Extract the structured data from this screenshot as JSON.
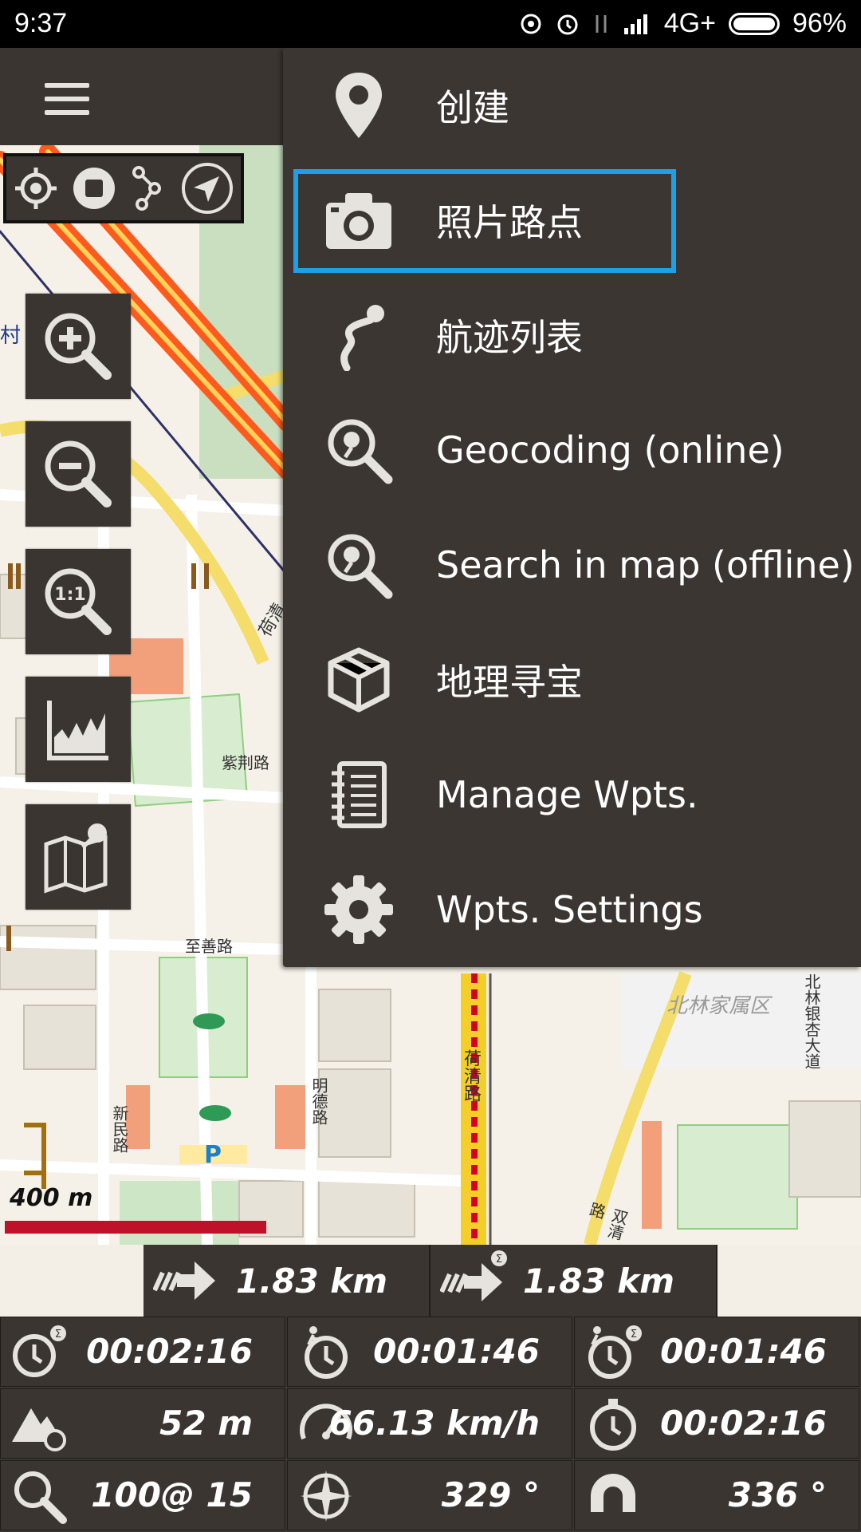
{
  "status_bar": {
    "time": "9:37",
    "network": "4G+",
    "battery": "96%"
  },
  "map": {
    "labels": {
      "road_1": "荷清",
      "road_2": "紫荆路",
      "road_3": "至善路",
      "road_4": "明德路",
      "road_5": "新民路",
      "road_6": "荷清路",
      "road_7": "双清路",
      "road_8": "北林家属区",
      "road_9": "北林银杏大道",
      "edge_char": "村",
      "parking": "P"
    },
    "scale_label": "400 m"
  },
  "menu": {
    "items": [
      {
        "label": "创建",
        "icon": "map-pin-icon"
      },
      {
        "label": "照片路点",
        "icon": "camera-icon"
      },
      {
        "label": "航迹列表",
        "icon": "track-icon"
      },
      {
        "label": "Geocoding (online)",
        "icon": "search-pin-icon"
      },
      {
        "label": "Search in map (offline)",
        "icon": "search-pin-icon"
      },
      {
        "label": "地理寻宝",
        "icon": "cube-icon"
      },
      {
        "label": "Manage Wpts.",
        "icon": "notebook-icon"
      },
      {
        "label": "Wpts. Settings",
        "icon": "gear-icon"
      }
    ]
  },
  "dashboard": {
    "distance_1": "1.83 km",
    "distance_2": "1.83 km",
    "rows": [
      [
        {
          "icon": "stopwatch-sum-icon",
          "value": "00:02:16"
        },
        {
          "icon": "moving-timer-icon",
          "value": "00:01:46"
        },
        {
          "icon": "moving-timer-sum-icon",
          "value": "00:01:46"
        }
      ],
      [
        {
          "icon": "altitude-icon",
          "value": "52 m"
        },
        {
          "icon": "speedometer-icon",
          "value": "66.13 km/h"
        },
        {
          "icon": "stopwatch-icon",
          "value": "00:02:16"
        }
      ],
      [
        {
          "icon": "zoom-level-icon",
          "value": "100@ 15"
        },
        {
          "icon": "compass-icon",
          "value": "329 °"
        },
        {
          "icon": "magnet-icon",
          "value": "336 °"
        }
      ]
    ]
  },
  "colors": {
    "panel": "#3a3531",
    "menu": "#3b3632",
    "highlight": "#1ea0e6",
    "scale_bar": "#c0112a"
  }
}
